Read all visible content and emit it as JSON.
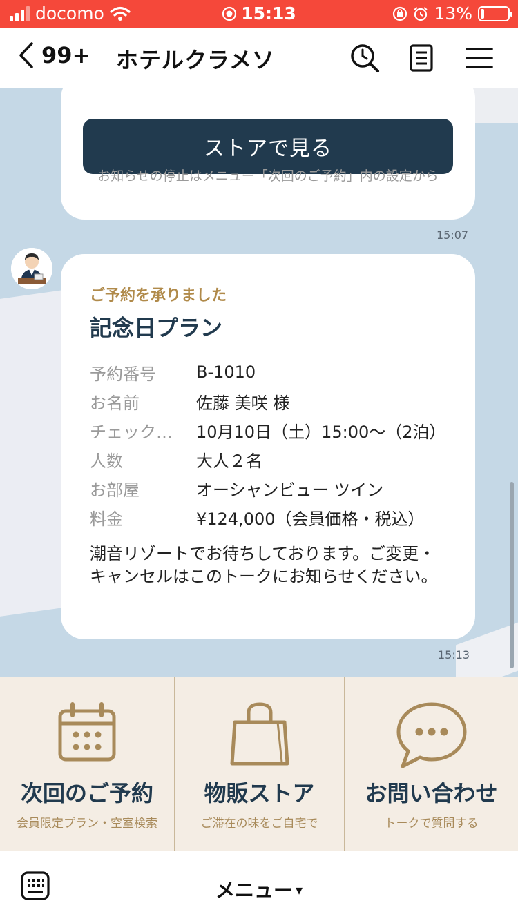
{
  "status_bar": {
    "carrier": "docomo",
    "time": "15:13",
    "battery": "13%",
    "battery_level": 0.13
  },
  "header": {
    "back_count": "99+",
    "title": "ホテルクラメソ"
  },
  "messages": {
    "store_button": "ストアで見る",
    "notice": "お知らせの停止はメニュー「次回のご予約」内の設定から",
    "time1": "15:07",
    "booking": {
      "subtitle": "ご予約を承りました",
      "title": "記念日プラン",
      "rows": [
        {
          "label": "予約番号",
          "value": "B-1010"
        },
        {
          "label": "お名前",
          "value": "佐藤 美咲 様"
        },
        {
          "label": "チェック…",
          "value": "10月10日（土）15:00～（2泊）"
        },
        {
          "label": "人数",
          "value": "大人２名"
        },
        {
          "label": "お部屋",
          "value": "オーシャンビュー ツイン"
        },
        {
          "label": "料金",
          "value": "¥124,000（会員価格・税込）"
        }
      ],
      "message": "潮音リゾートでお待ちしております。ご変更・キャンセルはこのトークにお知らせください。"
    },
    "time2": "15:13"
  },
  "rich_menu": {
    "items": [
      {
        "title": "次回のご予約",
        "subtitle": "会員限定プラン・空室検索",
        "icon": "calendar-icon"
      },
      {
        "title": "物販ストア",
        "subtitle": "ご滞在の味をご自宅で",
        "icon": "shopping-bag-icon"
      },
      {
        "title": "お問い合わせ",
        "subtitle": "トークで質問する",
        "icon": "chat-bubble-icon"
      }
    ]
  },
  "bottom_bar": {
    "menu_label": "メニュー",
    "menu_arrow": "▾"
  },
  "colors": {
    "status_bar": "#f5483a",
    "chat_bg": "#c5d8e6",
    "navy": "#213a4e",
    "gold": "#b08a4a",
    "menu_bg": "#f4ede4"
  }
}
